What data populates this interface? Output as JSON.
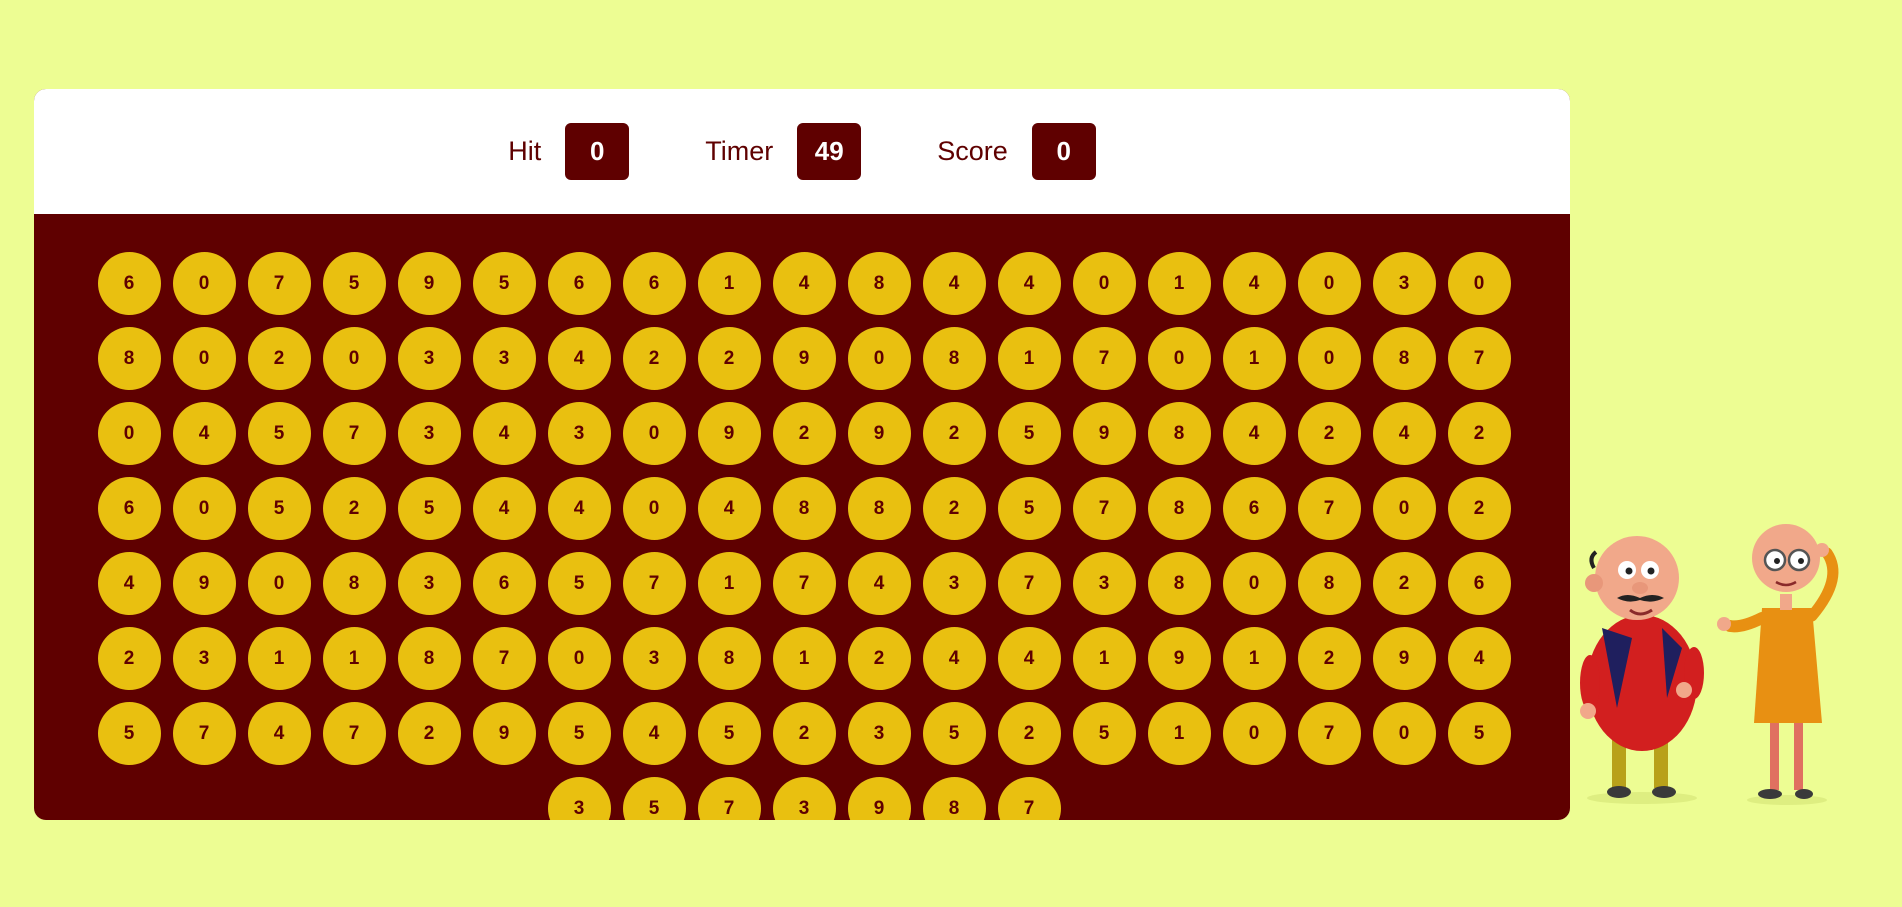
{
  "hud": {
    "hit_label": "Hit",
    "hit_value": "0",
    "timer_label": "Timer",
    "timer_value": "49",
    "score_label": "Score",
    "score_value": "0"
  },
  "bubbles": [
    "6",
    "0",
    "7",
    "5",
    "9",
    "5",
    "6",
    "6",
    "1",
    "4",
    "8",
    "4",
    "4",
    "0",
    "1",
    "4",
    "0",
    "3",
    "0",
    "8",
    "0",
    "2",
    "0",
    "3",
    "3",
    "4",
    "2",
    "2",
    "9",
    "0",
    "8",
    "1",
    "7",
    "0",
    "1",
    "0",
    "8",
    "7",
    "0",
    "4",
    "5",
    "7",
    "3",
    "4",
    "3",
    "0",
    "9",
    "2",
    "9",
    "2",
    "5",
    "9",
    "8",
    "4",
    "2",
    "4",
    "2",
    "6",
    "0",
    "5",
    "2",
    "5",
    "4",
    "4",
    "0",
    "4",
    "8",
    "8",
    "2",
    "5",
    "7",
    "8",
    "6",
    "7",
    "0",
    "2",
    "4",
    "9",
    "0",
    "8",
    "3",
    "6",
    "5",
    "7",
    "1",
    "7",
    "4",
    "3",
    "7",
    "3",
    "8",
    "0",
    "8",
    "2",
    "6",
    "2",
    "3",
    "1",
    "1",
    "8",
    "7",
    "0",
    "3",
    "8",
    "1",
    "2",
    "4",
    "4",
    "1",
    "9",
    "1",
    "2",
    "9",
    "4",
    "5",
    "7",
    "4",
    "7",
    "2",
    "9",
    "5",
    "4",
    "5",
    "2",
    "3",
    "5",
    "2",
    "5",
    "1",
    "0",
    "7",
    "0",
    "5",
    "3",
    "5",
    "7",
    "3",
    "9",
    "8",
    "7"
  ],
  "colors": {
    "page_background": "#edfd93",
    "panel_maroon": "#5f0000",
    "bubble_yellow": "#e9c010",
    "header_white": "#ffffff"
  },
  "illustration": {
    "icon": "cartoon-characters"
  }
}
